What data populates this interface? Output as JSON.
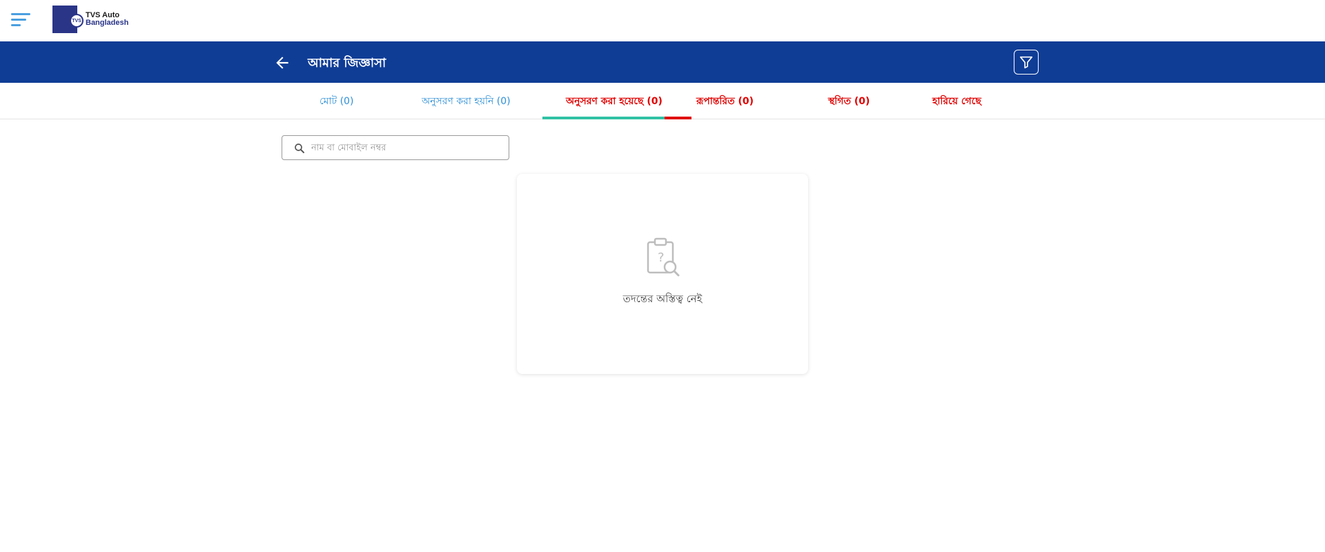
{
  "app": {
    "logo_line1": "TVS Auto",
    "logo_line2": "Bangladesh",
    "logo_badge": "TVS"
  },
  "header": {
    "title": "আমার জিজ্ঞাসা"
  },
  "tabs": [
    {
      "label": "মোট (0)",
      "state": "default"
    },
    {
      "label": "অনুসরণ করা হয়নি (0)",
      "state": "default"
    },
    {
      "label": "অনুসরণ করা হয়েছে (0)",
      "state": "active"
    },
    {
      "label": "রূপান্তরিত (0)",
      "state": "highlight"
    },
    {
      "label": "স্থগিত (0)",
      "state": "highlight"
    },
    {
      "label": "হারিয়ে গেছে",
      "state": "highlight"
    }
  ],
  "search": {
    "placeholder": "নাম বা মোবাইল নম্বর",
    "value": ""
  },
  "empty_state": {
    "message": "তদন্তের অস্তিত্ব নেই",
    "icon": "clipboard-search-icon"
  },
  "colors": {
    "header_bg": "#0f3d96",
    "tab_default": "#2e8fd6",
    "tab_highlight": "#e00000",
    "indicator": "#2fc1a4",
    "logo": "#2a3588"
  }
}
